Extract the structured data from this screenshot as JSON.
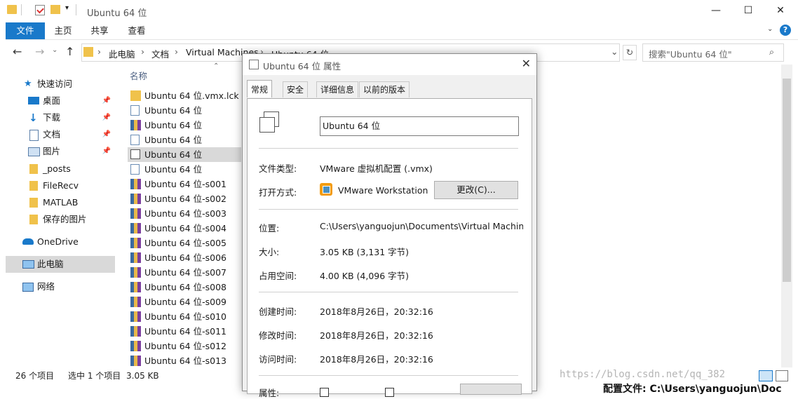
{
  "window": {
    "title": "Ubuntu 64 位",
    "controls": {
      "minimize": "—",
      "maximize": "☐",
      "close": "✕"
    },
    "ribbon_tabs": [
      "文件",
      "主页",
      "共享",
      "查看"
    ],
    "help": "?"
  },
  "address": {
    "crumbs": [
      "此电脑",
      "文档",
      "Virtual Machines",
      "Ubuntu 64 位"
    ],
    "search_placeholder": "搜索\"Ubuntu 64 位\""
  },
  "nav": {
    "items": [
      {
        "label": "快速访问",
        "icon": "star-icon",
        "pinned": false
      },
      {
        "label": "桌面",
        "icon": "desktop-icon",
        "pinned": true
      },
      {
        "label": "下载",
        "icon": "download-icon",
        "pinned": true
      },
      {
        "label": "文档",
        "icon": "document-icon",
        "pinned": true
      },
      {
        "label": "图片",
        "icon": "picture-icon",
        "pinned": true
      },
      {
        "label": "_posts",
        "icon": "folder-icon",
        "pinned": false
      },
      {
        "label": "FileRecv",
        "icon": "folder-icon",
        "pinned": false
      },
      {
        "label": "MATLAB",
        "icon": "folder-icon",
        "pinned": false
      },
      {
        "label": "保存的图片",
        "icon": "folder-icon",
        "pinned": false
      },
      {
        "label": "OneDrive",
        "icon": "cloud-icon",
        "pinned": false
      },
      {
        "label": "此电脑",
        "icon": "computer-icon",
        "pinned": false
      },
      {
        "label": "网络",
        "icon": "network-icon",
        "pinned": false
      }
    ]
  },
  "files": {
    "column_header": "名称",
    "rows": [
      {
        "name": "Ubuntu 64 位.vmx.lck",
        "icon": "folder-icon"
      },
      {
        "name": "Ubuntu 64 位",
        "icon": "doc-file-icon"
      },
      {
        "name": "Ubuntu 64 位",
        "icon": "archive-icon"
      },
      {
        "name": "Ubuntu 64 位",
        "icon": "doc-file-icon"
      },
      {
        "name": "Ubuntu 64 位",
        "icon": "vm-config-icon",
        "selected": true
      },
      {
        "name": "Ubuntu 64 位",
        "icon": "doc-file-icon"
      },
      {
        "name": "Ubuntu 64 位-s001",
        "icon": "archive-icon"
      },
      {
        "name": "Ubuntu 64 位-s002",
        "icon": "archive-icon"
      },
      {
        "name": "Ubuntu 64 位-s003",
        "icon": "archive-icon"
      },
      {
        "name": "Ubuntu 64 位-s004",
        "icon": "archive-icon"
      },
      {
        "name": "Ubuntu 64 位-s005",
        "icon": "archive-icon"
      },
      {
        "name": "Ubuntu 64 位-s006",
        "icon": "archive-icon"
      },
      {
        "name": "Ubuntu 64 位-s007",
        "icon": "archive-icon"
      },
      {
        "name": "Ubuntu 64 位-s008",
        "icon": "archive-icon"
      },
      {
        "name": "Ubuntu 64 位-s009",
        "icon": "archive-icon"
      },
      {
        "name": "Ubuntu 64 位-s010",
        "icon": "archive-icon"
      },
      {
        "name": "Ubuntu 64 位-s011",
        "icon": "archive-icon"
      },
      {
        "name": "Ubuntu 64 位-s012",
        "icon": "archive-icon"
      },
      {
        "name": "Ubuntu 64 位-s013",
        "icon": "archive-icon"
      }
    ]
  },
  "status": {
    "count": "26 个项目",
    "selection": "选中 1 个项目",
    "size": "3.05 KB"
  },
  "watermark": "https://blog.csdn.net/qq_382",
  "background_text": "配置文件: C:\\Users\\yanguojun\\Doc",
  "dialog": {
    "title": "Ubuntu 64 位 属性",
    "tabs": [
      "常规",
      "安全",
      "详细信息",
      "以前的版本"
    ],
    "name_value": "Ubuntu 64 位",
    "type_label": "文件类型:",
    "type_value": "VMware 虚拟机配置 (.vmx)",
    "open_label": "打开方式:",
    "open_value": "VMware Workstation",
    "change_button": "更改(C)...",
    "location_label": "位置:",
    "location_value": "C:\\Users\\yanguojun\\Documents\\Virtual Machines\\",
    "size_label": "大小:",
    "size_value": "3.05 KB (3,131 字节)",
    "disk_label": "占用空间:",
    "disk_value": "4.00 KB (4,096 字节)",
    "created_label": "创建时间:",
    "created_value": "2018年8月26日，20:32:16",
    "modified_label": "修改时间:",
    "modified_value": "2018年8月26日，20:32:16",
    "accessed_label": "访问时间:",
    "accessed_value": "2018年8月26日，20:32:16",
    "attr_label": "属性:"
  },
  "colors": {
    "accent": "#1979ca",
    "folder": "#f0c24b",
    "selection": "#d9d9d9"
  }
}
